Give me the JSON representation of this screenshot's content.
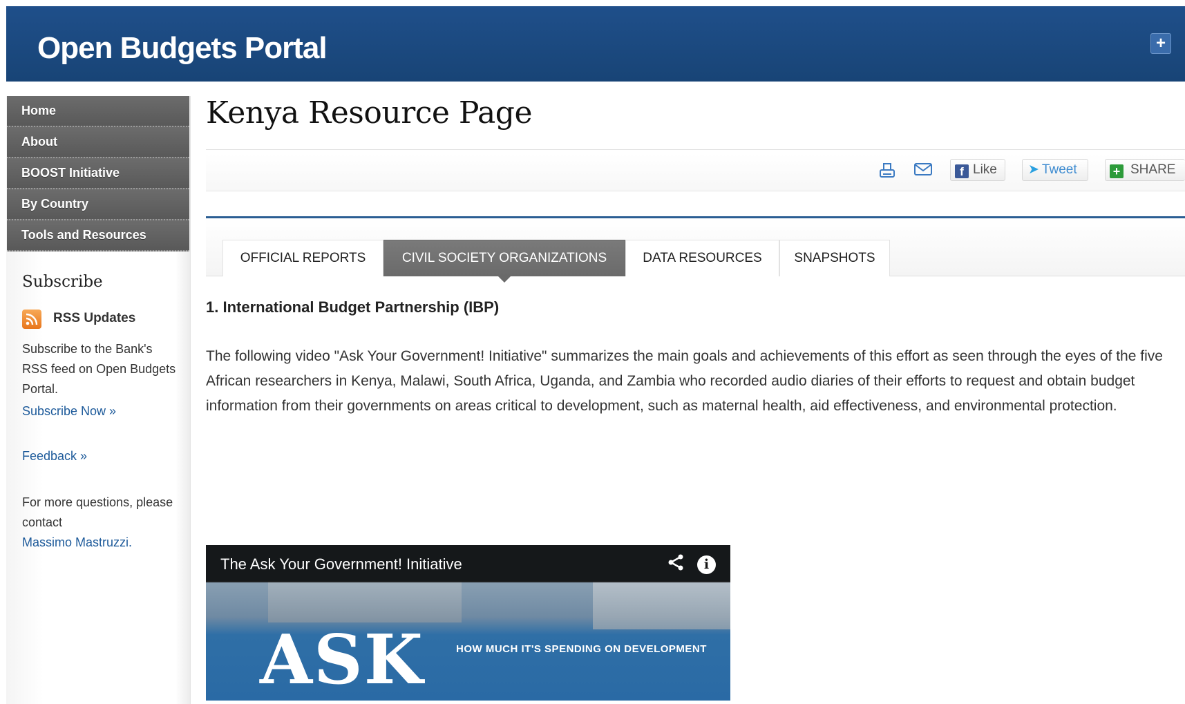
{
  "header": {
    "title": "Open Budgets Portal",
    "plus_icon": "+"
  },
  "nav": {
    "items": [
      {
        "label": "Home"
      },
      {
        "label": "About"
      },
      {
        "label": "BOOST Initiative"
      },
      {
        "label": "By Country"
      },
      {
        "label": "Tools and Resources"
      }
    ]
  },
  "sidebar": {
    "subscribe_title": "Subscribe",
    "rss_icon": "rss-icon",
    "rss_label": "RSS Updates",
    "subscribe_text": "Subscribe to the Bank's RSS feed on Open Budgets Portal.",
    "subscribe_now": "Subscribe Now »",
    "feedback": "Feedback »",
    "contact_text": "For more questions, please contact",
    "contact_name": "Massimo Mastruzzi."
  },
  "main": {
    "page_title": "Kenya Resource Page",
    "share": {
      "print_icon": "print-icon",
      "mail_icon": "mail-icon",
      "like_label": "Like",
      "tweet_label": "Tweet",
      "share_label": "SHARE"
    },
    "tabs": [
      {
        "label": "OFFICIAL REPORTS",
        "active": false
      },
      {
        "label": "CIVIL SOCIETY ORGANIZATIONS",
        "active": true
      },
      {
        "label": "DATA RESOURCES",
        "active": false
      },
      {
        "label": "SNAPSHOTS",
        "active": false
      }
    ],
    "section_heading": "1. International Budget Partnership (IBP)",
    "body_text": "The following video \"Ask Your Government! Initiative\" summarizes the main goals and achievements of this effort as seen through the eyes of the five African researchers in Kenya, Malawi, South Africa, Uganda, and Zambia who recorded audio diaries of their efforts to request and obtain budget information from their governments on areas critical to development, such as maternal health, aid effectiveness, and environmental protection.",
    "video": {
      "title": "The Ask Your Government! Initiative",
      "thumbnail_headline": "ASK",
      "thumbnail_subline": "HOW MUCH IT'S SPENDING ON DEVELOPMENT"
    }
  },
  "colors": {
    "header_blue": "#1f4f8a",
    "nav_gray": "#5f5f5f",
    "link_blue": "#1d5a9a",
    "active_tab": "#6e6e6e"
  }
}
